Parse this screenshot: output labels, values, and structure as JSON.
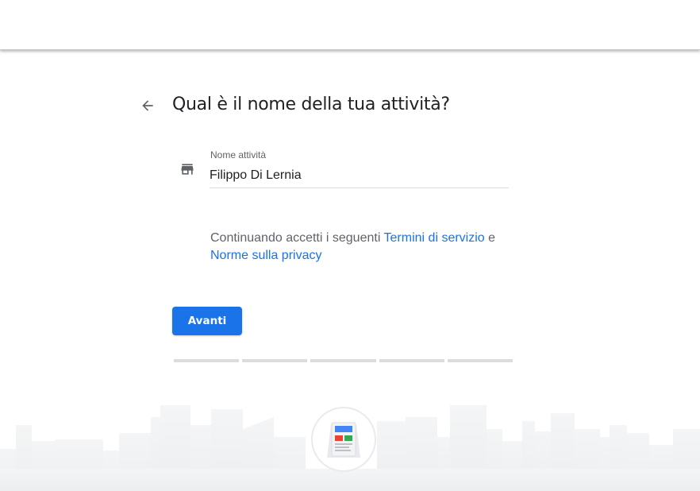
{
  "header": {
    "back_icon": "arrow-back-icon",
    "title": "Qual è il nome della tua attività?"
  },
  "form": {
    "store_icon": "storefront-icon",
    "business_name_label": "Nome attività",
    "business_name_value": "Filippo Di Lernia"
  },
  "terms": {
    "prefix": "Continuando accetti i seguenti ",
    "terms_link": "Termini di servizio",
    "conjunction": " e ",
    "privacy_link": "Norme sulla privacy"
  },
  "actions": {
    "next_label": "Avanti"
  },
  "progress": {
    "total_steps": 5,
    "completed_steps": 0
  },
  "colors": {
    "accent": "#1a73e8",
    "title_text": "#202124",
    "secondary_text": "#5f6368",
    "progress_inactive": "#dadce0"
  },
  "footer": {
    "illustration": "city-skyline-with-storefront-badge"
  }
}
